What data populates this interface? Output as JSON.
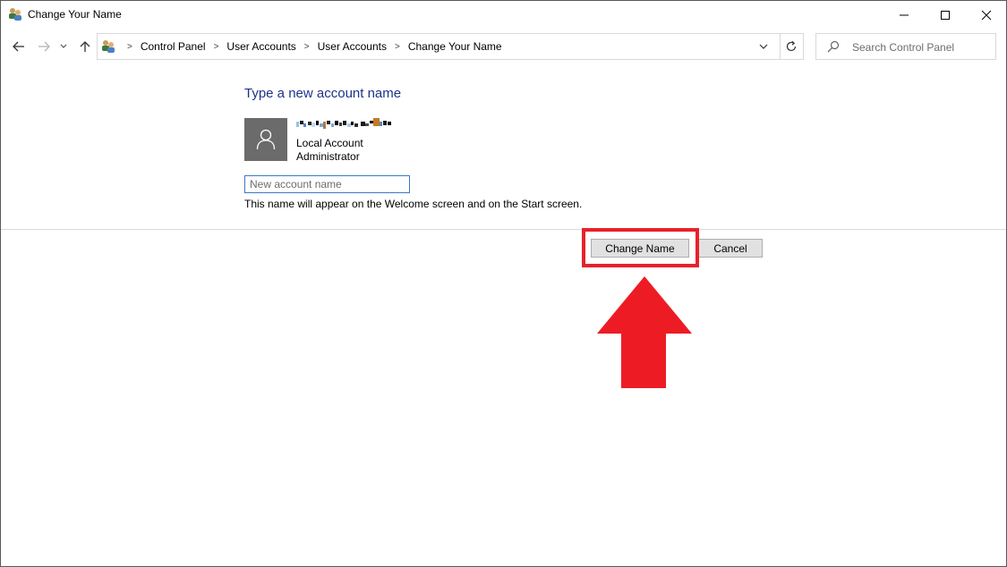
{
  "window": {
    "title": "Change Your Name",
    "controls": [
      "minimize",
      "maximize",
      "close"
    ]
  },
  "nav": {
    "breadcrumbs": [
      "Control Panel",
      "User Accounts",
      "User Accounts",
      "Change Your Name"
    ],
    "breadcrumb_separator": ">",
    "refresh_symbol": "↻"
  },
  "search": {
    "placeholder": "Search Control Panel"
  },
  "content": {
    "heading": "Type a new account name",
    "account_type": "Local Account",
    "account_role": "Administrator",
    "name_input_placeholder": "New account name",
    "name_input_value": "",
    "hint": "This name will appear on the Welcome screen and on the Start screen."
  },
  "buttons": {
    "change_name": "Change Name",
    "cancel": "Cancel"
  },
  "colors": {
    "heading": "#1e3287",
    "annotation_red": "#e8212b",
    "avatar_bg": "#6b6b6b",
    "input_border": "#3c78c8"
  },
  "icons": {
    "title": "user-accounts-icon",
    "address": "user-accounts-icon",
    "avatar": "user-silhouette-icon",
    "search": "search-icon"
  }
}
